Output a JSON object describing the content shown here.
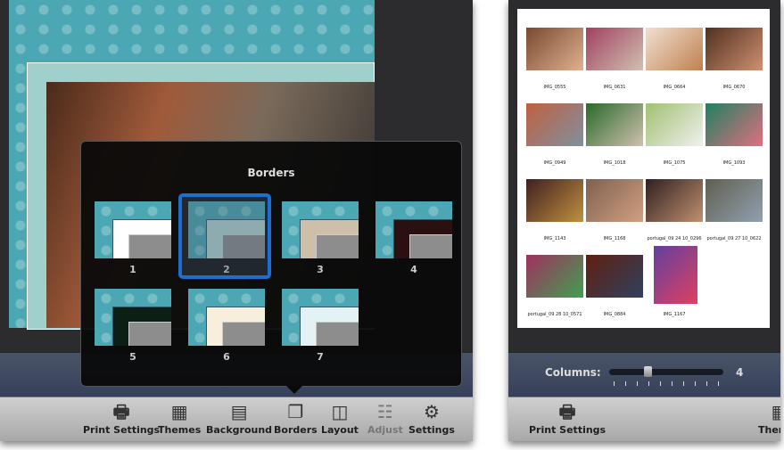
{
  "left_window": {
    "popover": {
      "title": "Borders",
      "selected": "2",
      "items": [
        {
          "label": "1",
          "mat": "#ffffff"
        },
        {
          "label": "2",
          "mat": "#b5d9d4"
        },
        {
          "label": "3",
          "mat": "#cdbfa9"
        },
        {
          "label": "4",
          "mat": "#2a1010"
        },
        {
          "label": "5",
          "mat": "#0b1f14"
        },
        {
          "label": "6",
          "mat": "#f7efdc"
        },
        {
          "label": "7",
          "mat": "#e3f3f5"
        }
      ]
    },
    "toolbar": [
      {
        "label": "Print Settings",
        "icon": "printer-icon"
      },
      {
        "label": "Themes",
        "icon": "themes-icon"
      },
      {
        "label": "Background",
        "icon": "swatch-fan-icon"
      },
      {
        "label": "Borders",
        "icon": "borders-icon"
      },
      {
        "label": "Layout",
        "icon": "layout-icon"
      },
      {
        "label": "Adjust",
        "icon": "sliders-icon",
        "disabled": true
      },
      {
        "label": "Settings",
        "icon": "gear-icon"
      }
    ]
  },
  "right_window": {
    "photos": [
      {
        "name": "IMG_0555"
      },
      {
        "name": "IMG_0631"
      },
      {
        "name": "IMG_0664"
      },
      {
        "name": "IMG_0670"
      },
      {
        "name": "IMG_0949"
      },
      {
        "name": "IMG_1018"
      },
      {
        "name": "IMG_1075"
      },
      {
        "name": "IMG_1093"
      },
      {
        "name": "IMG_1143"
      },
      {
        "name": "IMG_1168"
      },
      {
        "name": "portugal_09 24 10_0296"
      },
      {
        "name": "portugal_09 27 10_0622"
      },
      {
        "name": "portugal_09 28 10_0571"
      },
      {
        "name": "IMG_0884"
      },
      {
        "name": "IMG_1167"
      }
    ],
    "columns": {
      "label": "Columns:",
      "value": "4",
      "min": 1,
      "max": 10
    },
    "toolbar": [
      {
        "label": "Print Settings",
        "icon": "printer-icon"
      },
      {
        "label": "Themes",
        "icon": "themes-icon"
      }
    ]
  },
  "colors": {
    "selection": "#1a6fd0",
    "teal": "#4aa7b3"
  }
}
